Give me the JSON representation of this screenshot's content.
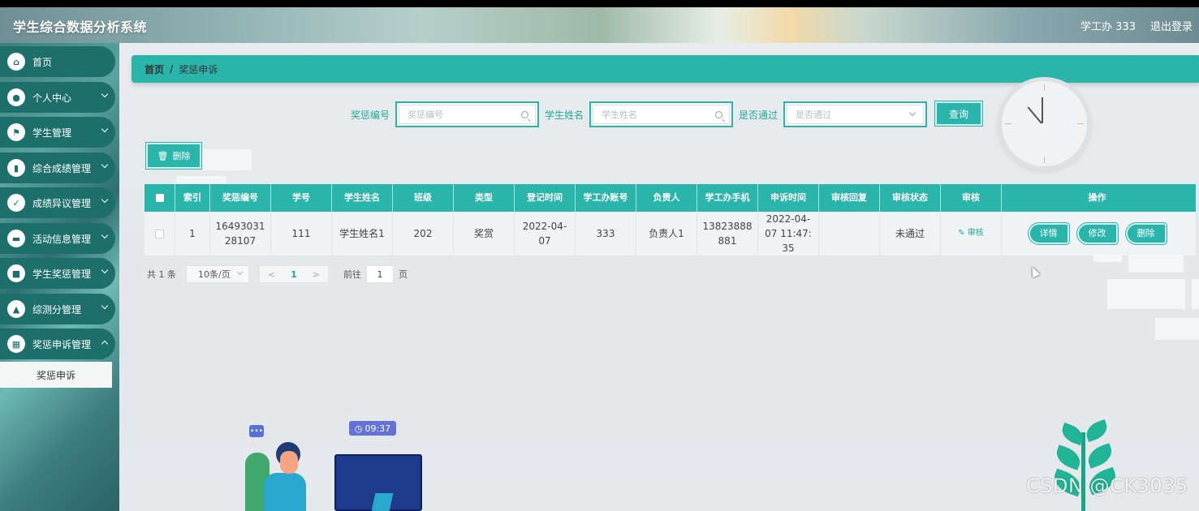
{
  "app": {
    "title": "学生综合数据分析系统",
    "user": "学工办 333",
    "logout": "退出登录"
  },
  "sidebar": {
    "items": [
      {
        "label": "首页",
        "icon": "home-icon",
        "glyph": "⌂"
      },
      {
        "label": "个人中心",
        "icon": "user-icon",
        "glyph": "●"
      },
      {
        "label": "学生管理",
        "icon": "flag-icon",
        "glyph": "⚑"
      },
      {
        "label": "综合成绩管理",
        "icon": "book-icon",
        "glyph": "▮"
      },
      {
        "label": "成绩异议管理",
        "icon": "clipboard-icon",
        "glyph": "✓"
      },
      {
        "label": "活动信息管理",
        "icon": "briefcase-icon",
        "glyph": "▬"
      },
      {
        "label": "学生奖惩管理",
        "icon": "message-icon",
        "glyph": "■"
      },
      {
        "label": "综测分管理",
        "icon": "person-icon",
        "glyph": "▲"
      },
      {
        "label": "奖惩申诉管理",
        "icon": "grid-icon",
        "glyph": "▦"
      }
    ],
    "submenu": {
      "label": "奖惩申诉"
    }
  },
  "breadcrumb": {
    "home": "首页",
    "separator": "/",
    "current": "奖惩申诉"
  },
  "search": {
    "award_label": "奖惩编号",
    "award_placeholder": "奖惩编号",
    "name_label": "学生姓名",
    "name_placeholder": "学生姓名",
    "passed_label": "是否通过",
    "passed_placeholder": "是否通过",
    "query_button": "查询"
  },
  "toolbar": {
    "delete_button": "删除"
  },
  "table": {
    "headers": [
      "索引",
      "奖惩编号",
      "学号",
      "学生姓名",
      "班级",
      "类型",
      "登记时间",
      "学工办账号",
      "负责人",
      "学工办手机",
      "申诉时间",
      "审核回复",
      "审核状态",
      "审核",
      "操作"
    ],
    "rows": [
      {
        "index": "1",
        "award_no": "1649303128107",
        "student_no": "111",
        "student_name": "学生姓名1",
        "class": "202",
        "type": "奖赏",
        "register_time": "2022-04-07",
        "office_account": "333",
        "person_in_charge": "负责人1",
        "office_phone": "13823888881",
        "appeal_time": "2022-04-07 11:47:35",
        "audit_reply": "",
        "audit_status": "未通过",
        "audit_action": "审核",
        "actions": {
          "detail": "详情",
          "edit": "修改",
          "delete": "删除"
        }
      }
    ]
  },
  "pagination": {
    "total": "共 1 条",
    "page_size": "10条/页",
    "prev": "<",
    "current_page": "1",
    "next": ">",
    "goto_label": "前往",
    "goto_value": "1",
    "page_suffix": "页"
  },
  "illustration": {
    "time": "09:37",
    "bubble": "•••"
  },
  "watermark": "CSDN @CK3035",
  "colors": {
    "accent": "#29b5aa",
    "sidebar_item": "#1d6f6c"
  }
}
